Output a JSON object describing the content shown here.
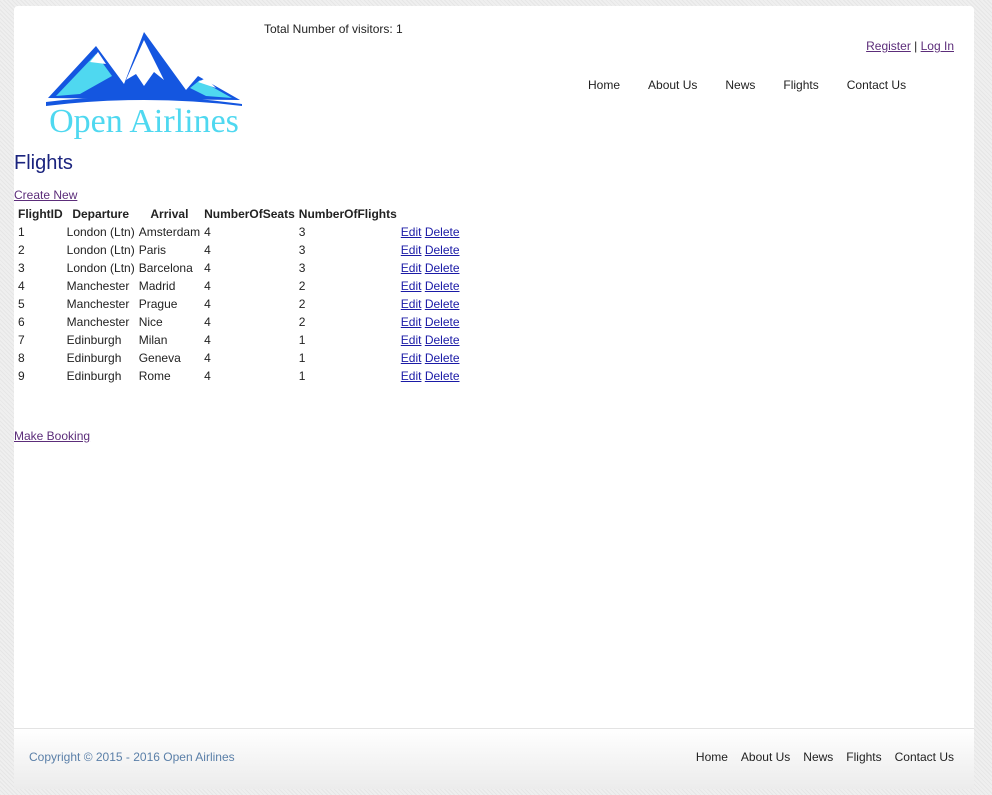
{
  "header": {
    "visitors": "Total Number of visitors: 1",
    "register_label": "Register",
    "auth_separator": "|",
    "login_label": "Log In",
    "logo_text": "Open Airlines",
    "nav": [
      "Home",
      "About Us",
      "News",
      "Flights",
      "Contact Us"
    ]
  },
  "main": {
    "title": "Flights",
    "create_label": "Create New",
    "booking_label": "Make Booking",
    "columns": [
      "FlightID",
      "Departure",
      "Arrival",
      "NumberOfSeats",
      "NumberOfFlights"
    ],
    "edit_label": "Edit",
    "delete_label": "Delete",
    "rows": [
      [
        "1",
        "London (Ltn)",
        "Amsterdam",
        "4",
        "3"
      ],
      [
        "2",
        "London (Ltn)",
        "Paris",
        "4",
        "3"
      ],
      [
        "3",
        "London (Ltn)",
        "Barcelona",
        "4",
        "3"
      ],
      [
        "4",
        "Manchester",
        "Madrid",
        "4",
        "2"
      ],
      [
        "5",
        "Manchester",
        "Prague",
        "4",
        "2"
      ],
      [
        "6",
        "Manchester",
        "Nice",
        "4",
        "2"
      ],
      [
        "7",
        "Edinburgh",
        "Milan",
        "4",
        "1"
      ],
      [
        "8",
        "Edinburgh",
        "Geneva",
        "4",
        "1"
      ],
      [
        "9",
        "Edinburgh",
        "Rome",
        "4",
        "1"
      ]
    ]
  },
  "footer": {
    "copyright": "Copyright © 2015 - 2016 Open Airlines",
    "nav": [
      "Home",
      "About Us",
      "News",
      "Flights",
      "Contact Us"
    ]
  },
  "colors": {
    "title": "#1a237e",
    "visited_link": "#5c2d7a",
    "link": "#1a1aa6",
    "copyright": "#5a7fa8",
    "logo_dark": "#1456e0",
    "logo_light": "#4fd8f0"
  }
}
